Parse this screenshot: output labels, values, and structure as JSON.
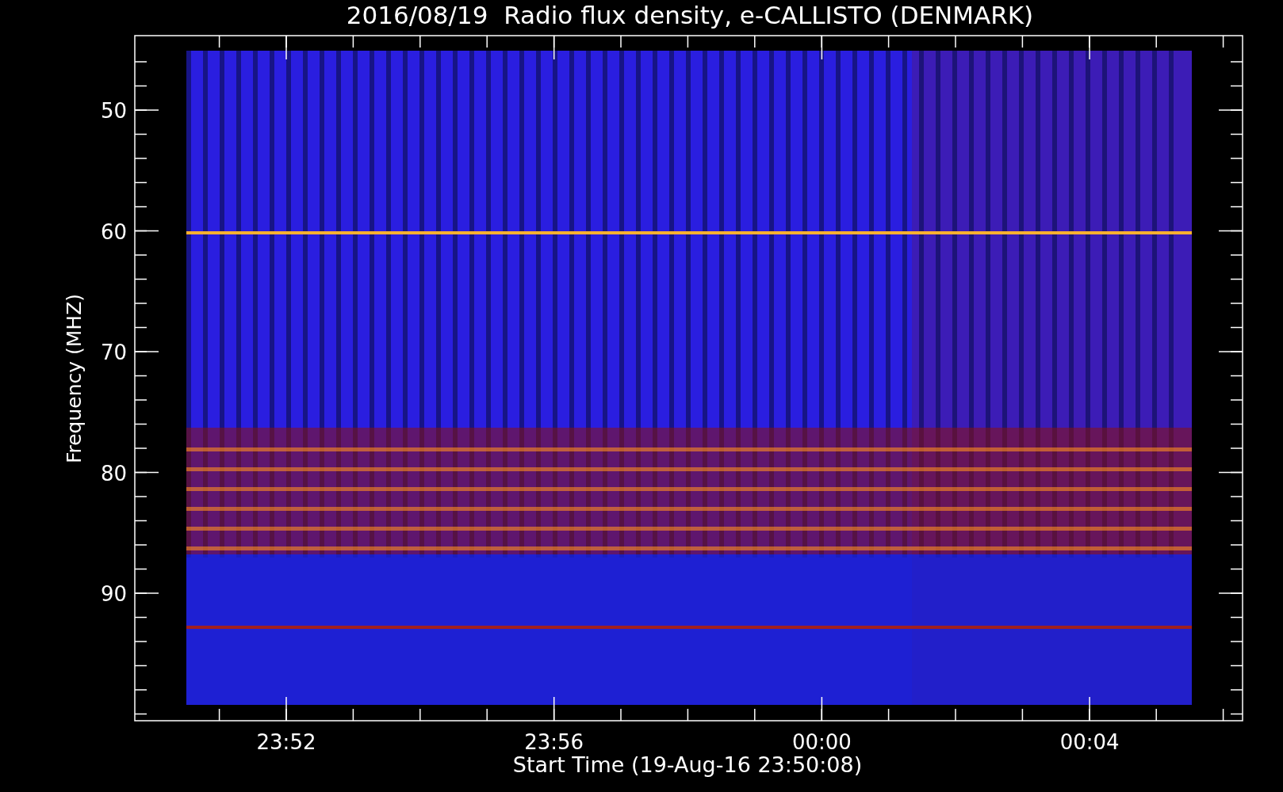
{
  "title": "2016/08/19  Radio flux density, e-CALLISTO (DENMARK)",
  "y_axis": {
    "label": "Frequency (MHZ)",
    "ticks": [
      "50",
      "60",
      "70",
      "80",
      "90"
    ]
  },
  "x_axis": {
    "label": "Start Time (19-Aug-16 23:50:08)",
    "ticks": [
      "23:52",
      "23:56",
      "00:00",
      "00:04"
    ]
  }
}
